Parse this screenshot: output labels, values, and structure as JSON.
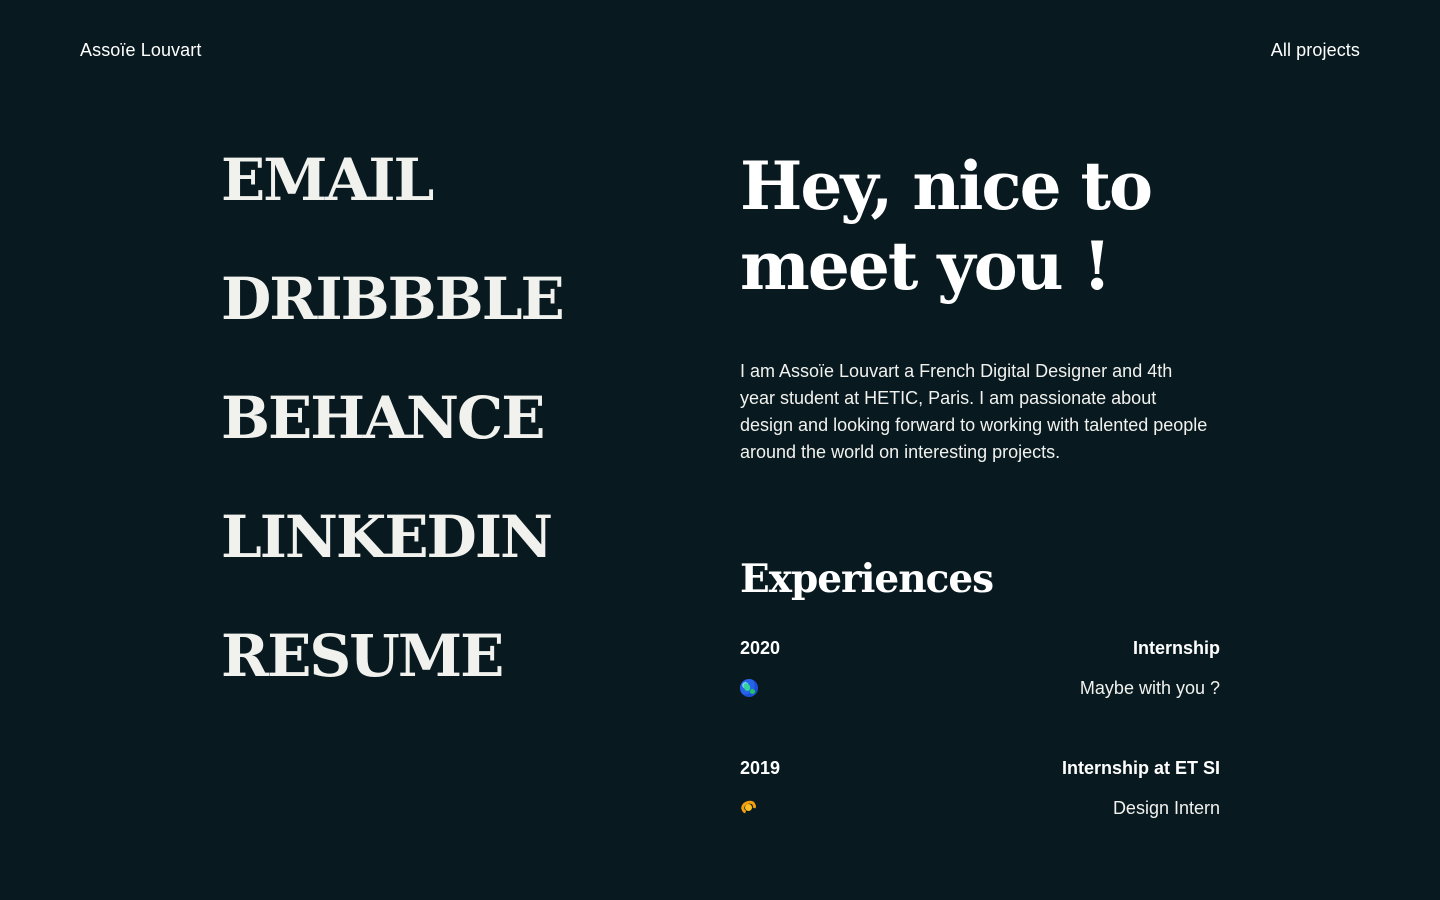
{
  "header": {
    "brand": "Assoïe Louvart",
    "nav_link": "All projects"
  },
  "links": [
    {
      "label": "EMAIL"
    },
    {
      "label": "DRIBBBLE"
    },
    {
      "label": "BEHANCE"
    },
    {
      "label": "LINKEDIN"
    },
    {
      "label": "RESUME"
    }
  ],
  "main": {
    "title_line_1": "Hey, nice to",
    "title_line_2": "meet you !",
    "intro": "I am Assoïe Louvart a French Digital Designer and 4th year student at HETIC, Paris. I am passionate about design and looking forward to working with talented people around the world on interesting projects.",
    "experiences_title": "Experiences",
    "experiences": [
      {
        "year": "2020",
        "role": "Internship",
        "icon": "globe-icon",
        "detail": "Maybe with you ?"
      },
      {
        "year": "2019",
        "role": "Internship at ET SI",
        "icon": "croissant-icon",
        "detail": "Design Intern"
      }
    ]
  },
  "colors": {
    "background": "#081a20",
    "text": "#f3f3f0"
  }
}
